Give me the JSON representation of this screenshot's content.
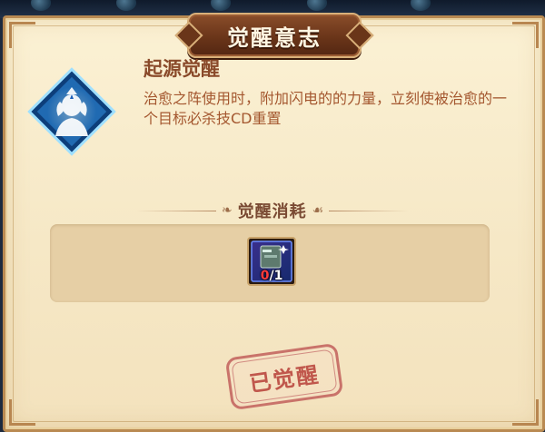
{
  "panel": {
    "title": "觉醒意志"
  },
  "skill": {
    "icon": "awakened-warrior-icon",
    "name": "起源觉醒",
    "description": "治愈之阵使用时，附加闪电的的力量，立刻使被治愈的一个目标必杀技CD重置"
  },
  "cost": {
    "section_title": "觉醒消耗",
    "items": [
      {
        "icon": "awakening-material-icon",
        "have": "0",
        "need": "1"
      }
    ],
    "count_separator": "/"
  },
  "status": {
    "stamp_label": "已觉醒"
  },
  "colors": {
    "parchment": "#f6e8c6",
    "title_plaque": "#6a3519",
    "text_brown": "#a4572f",
    "stamp_red": "#c0574c",
    "count_insufficient": "#ff3b3b",
    "icon_blue": "#2f8ee0"
  }
}
